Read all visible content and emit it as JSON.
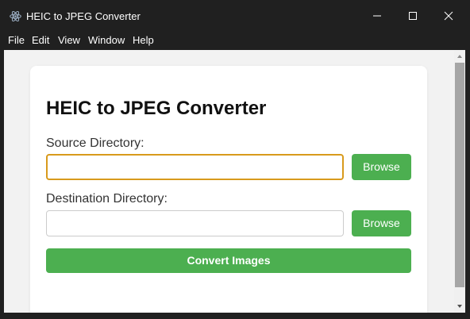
{
  "window": {
    "title": "HEIC to JPEG Converter",
    "icon": "electron-atom-icon"
  },
  "menu": {
    "items": [
      "File",
      "Edit",
      "View",
      "Window",
      "Help"
    ]
  },
  "form": {
    "heading": "HEIC to JPEG Converter",
    "source_label": "Source Directory:",
    "source_value": "",
    "source_browse": "Browse",
    "destination_label": "Destination Directory:",
    "destination_value": "",
    "destination_browse": "Browse",
    "convert_label": "Convert Images"
  },
  "colors": {
    "accent_green": "#4caf50",
    "focus_border": "#d89a1c",
    "titlebar_bg": "#202020",
    "content_bg": "#f2f2f2"
  }
}
